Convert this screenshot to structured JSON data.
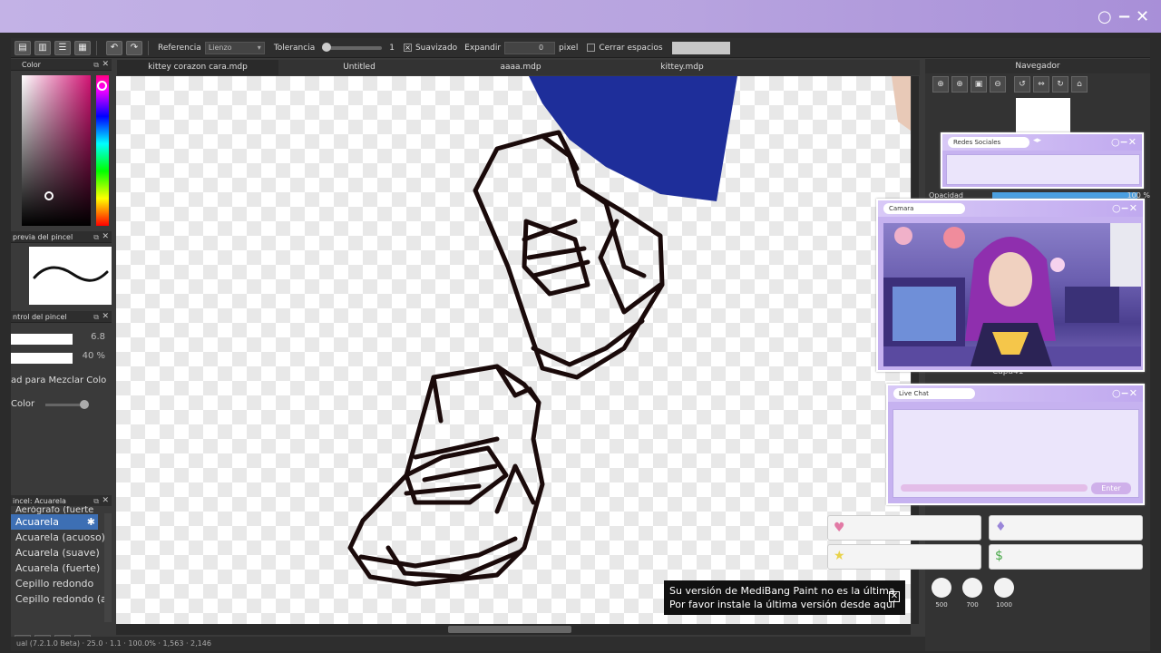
{
  "overlay": {
    "controls": [
      "○",
      "−",
      "✕"
    ]
  },
  "toolbar": {
    "referencia_label": "Referencia",
    "referencia_value": "Lienzo",
    "tolerancia_label": "Tolerancia",
    "tolerancia_value": "1",
    "suavizado_label": "Suavizado",
    "expandir_label": "Expandir",
    "expandir_value": "0",
    "pixel_label": "pixel",
    "cerrar_label": "Cerrar espacios"
  },
  "panels": {
    "color_title": "Color",
    "brush_preview_title": "previa del pincel",
    "brush_control_title": "ntrol del pincel",
    "size_value": "6.8",
    "opacity_value": "40 %",
    "mix_label": "ad para Mezclar Colo",
    "color_label": "Color",
    "brush_panel_title": "incel: Acuarela",
    "brushes": [
      "Aerógrafo (fuerte",
      "Acuarela",
      "Acuarela (acuoso)",
      "Acuarela (suave)",
      "Acuarela (fuerte)",
      "Cepillo redondo",
      "Cepillo redondo (a"
    ]
  },
  "tabs": [
    "kittey corazon cara.mdp",
    "Untitled",
    "aaaa.mdp",
    "kittey.mdp"
  ],
  "navigator": {
    "title": "Navegador",
    "opacity_label": "Opacidad",
    "opacity_value": "100 %",
    "layer_name": "Capa41"
  },
  "notice": {
    "line1": "Su versión de MediBang Paint no es la última",
    "line2": "Por favor instale la última versión desde aquí"
  },
  "widgets": {
    "social_title": "Redes Sociales",
    "camera_title": "Camara",
    "chat_title": "Live Chat",
    "chat_button": "Enter"
  },
  "bits": [
    "500",
    "700",
    "1000"
  ],
  "status": "ual (7.2.1.0 Beta) · 25.0 ·  1.1 · 100.0% · 1,563 · 2,146"
}
